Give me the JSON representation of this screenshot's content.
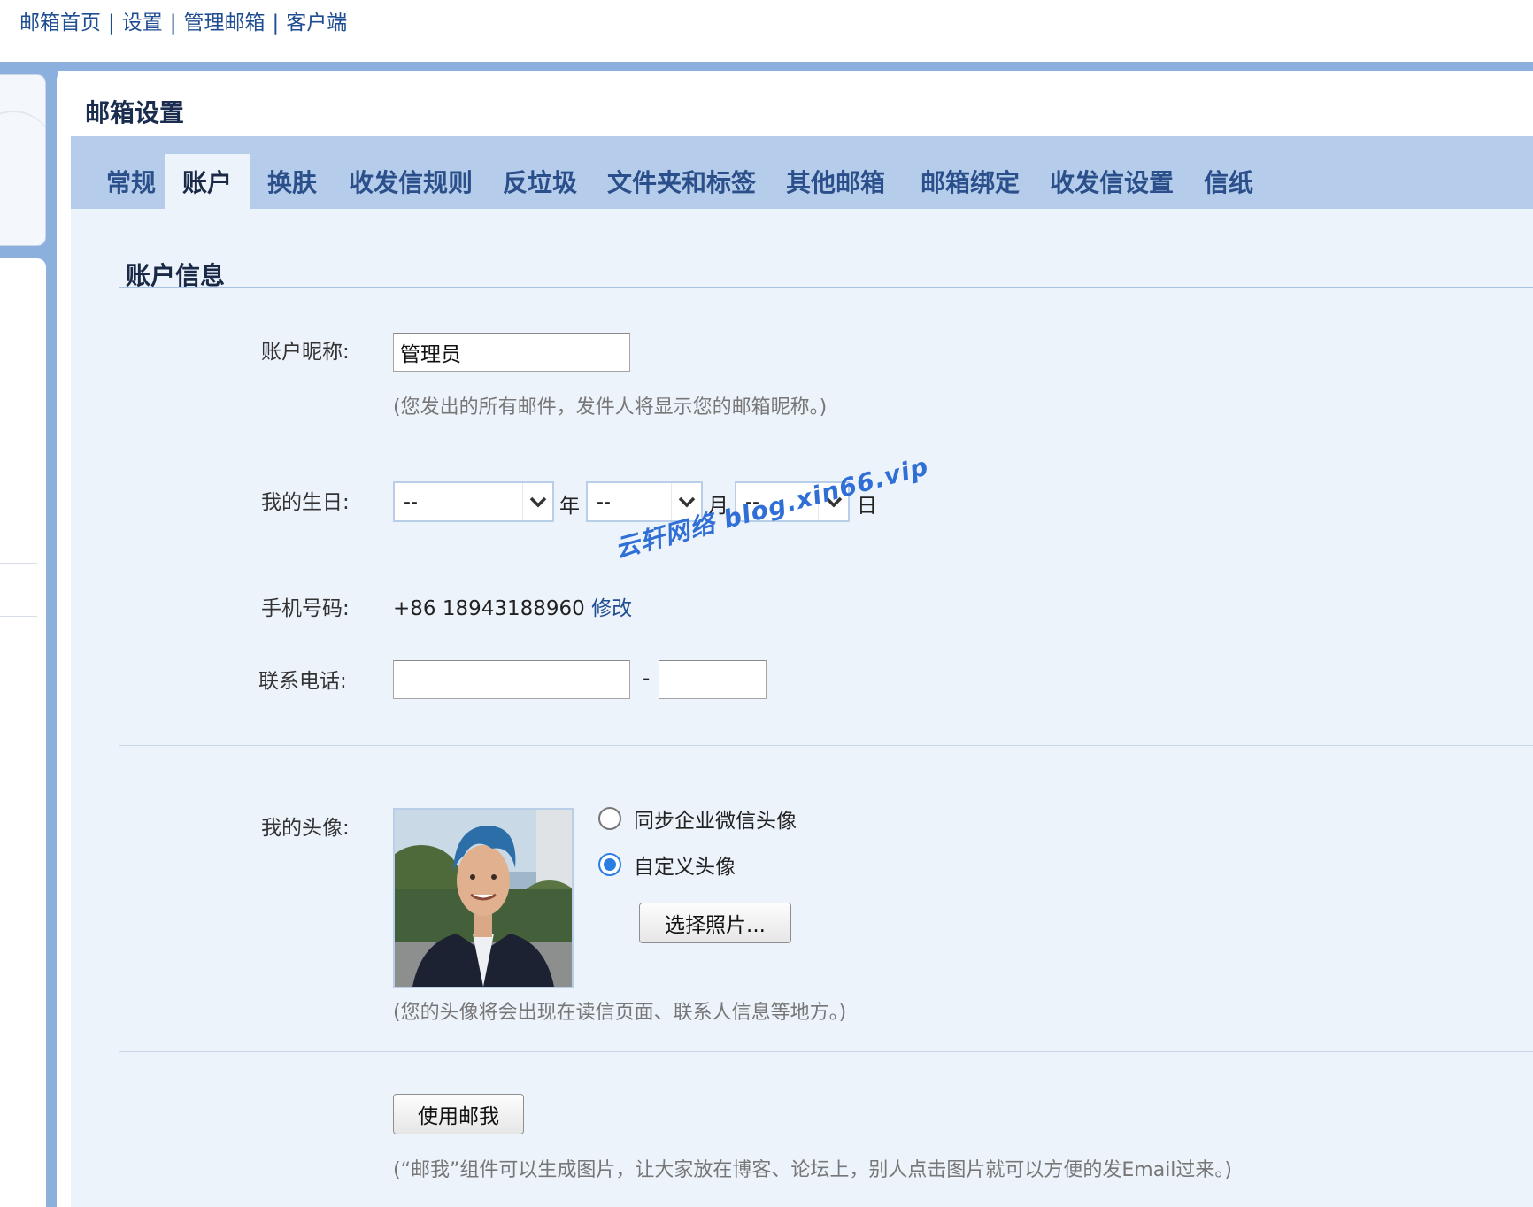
{
  "topnav": {
    "links": [
      "邮箱首页",
      "设置",
      "管理邮箱",
      "客户端"
    ],
    "separator": "|"
  },
  "page": {
    "title": "邮箱设置"
  },
  "tabs": [
    {
      "label": "常规",
      "active": false
    },
    {
      "label": "账户",
      "active": true
    },
    {
      "label": "换肤",
      "active": false
    },
    {
      "label": "收发信规则",
      "active": false
    },
    {
      "label": "反垃圾",
      "active": false
    },
    {
      "label": "文件夹和标签",
      "active": false
    },
    {
      "label": "其他邮箱",
      "active": false
    },
    {
      "label": "邮箱绑定",
      "active": false
    },
    {
      "label": "收发信设置",
      "active": false
    },
    {
      "label": "信纸",
      "active": false
    }
  ],
  "account": {
    "section_title": "账户信息",
    "nickname": {
      "label": "账户昵称:",
      "value": "管理员",
      "hint": "(您发出的所有邮件，发件人将显示您的邮箱昵称。)"
    },
    "birthday": {
      "label": "我的生日:",
      "year": "--",
      "year_unit": "年",
      "month": "--",
      "month_unit": "月",
      "day": "--",
      "day_unit": "日"
    },
    "mobile": {
      "label": "手机号码:",
      "value": "+86 18943188960",
      "modify_label": "修改"
    },
    "contact_phone": {
      "label": "联系电话:",
      "area_value": "",
      "number_value": "",
      "separator": "-"
    },
    "avatar": {
      "label": "我的头像:",
      "options": [
        {
          "label": "同步企业微信头像",
          "checked": false
        },
        {
          "label": "自定义头像",
          "checked": true
        }
      ],
      "choose_button": "选择照片...",
      "hint": "(您的头像将会出现在读信页面、联系人信息等地方。)"
    },
    "mailme": {
      "button": "使用邮我",
      "hint": "(“邮我”组件可以生成图片，让大家放在博客、论坛上，别人点击图片就可以方便的发Email过来。)"
    }
  },
  "watermark": "云轩网络 blog.xin66.vip",
  "colors": {
    "accent": "#8cb0de",
    "tab_bar": "#b5cdea",
    "content_bg": "#edf3fb",
    "link": "#1f4d91",
    "radio_checked": "#2a7de1"
  }
}
